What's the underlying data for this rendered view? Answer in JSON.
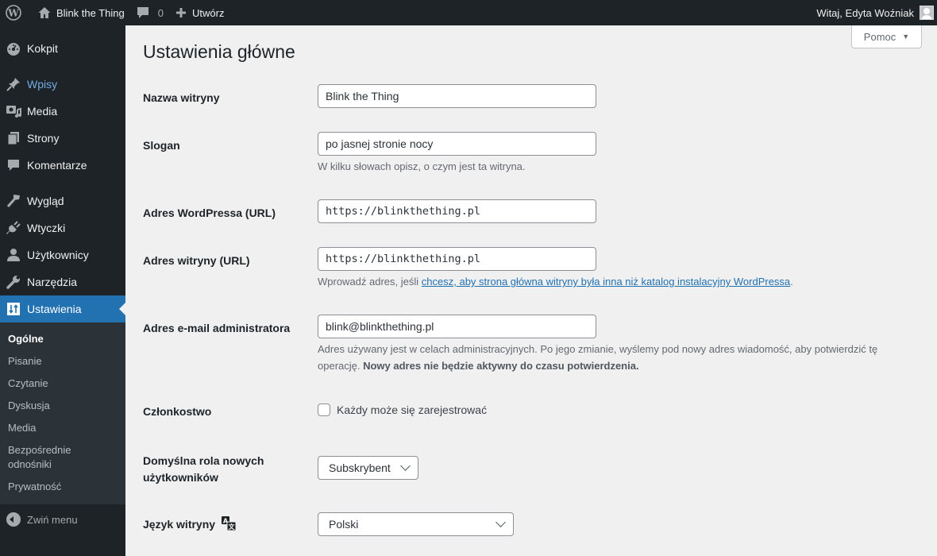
{
  "adminbar": {
    "site_name": "Blink the Thing",
    "comments_count": "0",
    "new_label": "Utwórz",
    "greeting": "Witaj, Edyta Woźniak"
  },
  "sidebar": {
    "items": [
      {
        "label": "Kokpit",
        "icon": "dashboard-icon"
      },
      {
        "label": "Wpisy",
        "icon": "pin-icon"
      },
      {
        "label": "Media",
        "icon": "media-icon"
      },
      {
        "label": "Strony",
        "icon": "pages-icon"
      },
      {
        "label": "Komentarze",
        "icon": "comment-icon"
      },
      {
        "label": "Wygląd",
        "icon": "brush-icon"
      },
      {
        "label": "Wtyczki",
        "icon": "plugin-icon"
      },
      {
        "label": "Użytkownicy",
        "icon": "user-icon"
      },
      {
        "label": "Narzędzia",
        "icon": "wrench-icon"
      },
      {
        "label": "Ustawienia",
        "icon": "settings-icon"
      }
    ],
    "submenu": [
      "Ogólne",
      "Pisanie",
      "Czytanie",
      "Dyskusja",
      "Media",
      "Bezpośrednie odnośniki",
      "Prywatność"
    ],
    "collapse_label": "Zwiń menu"
  },
  "help_label": "Pomoc",
  "page_title": "Ustawienia główne",
  "form": {
    "site_title": {
      "label": "Nazwa witryny",
      "value": "Blink the Thing"
    },
    "tagline": {
      "label": "Slogan",
      "value": "po jasnej stronie nocy",
      "description": "W kilku słowach opisz, o czym jest ta witryna."
    },
    "wp_url": {
      "label": "Adres WordPressa (URL)",
      "value": "https://blinkthething.pl"
    },
    "site_url": {
      "label": "Adres witryny (URL)",
      "value": "https://blinkthething.pl",
      "desc_prefix": "Wprowadź adres, jeśli ",
      "desc_link": "chcesz, aby strona główna witryny była inna niż katalog instalacyjny WordPressa",
      "desc_suffix": "."
    },
    "admin_email": {
      "label": "Adres e-mail administratora",
      "value": "blink@blinkthething.pl",
      "desc": "Adres używany jest w celach administracyjnych. Po jego zmianie, wyślemy pod nowy adres wiadomość, aby potwierdzić tę operację. ",
      "desc_bold": "Nowy adres nie będzie aktywny do czasu potwierdzenia."
    },
    "membership": {
      "label": "Członkostwo",
      "checkbox_label": "Każdy może się zarejestrować",
      "checked": false
    },
    "default_role": {
      "label": "Domyślna rola nowych użytkowników",
      "value": "Subskrybent"
    },
    "language": {
      "label": "Język witryny",
      "value": "Polski"
    }
  },
  "colors": {
    "accent": "#2271b1",
    "adminbar": "#1d2327",
    "link_hover": "#72aee6"
  }
}
